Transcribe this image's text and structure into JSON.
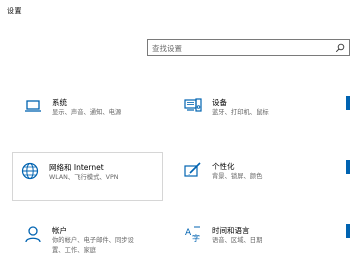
{
  "window": {
    "title": "设置"
  },
  "search": {
    "placeholder": "查找设置"
  },
  "tiles": [
    {
      "title": "系统",
      "desc": "显示、声音、通知、电源",
      "icon": "laptop-icon"
    },
    {
      "title": "设备",
      "desc": "蓝牙、打印机、鼠标",
      "icon": "devices-icon"
    },
    {
      "title": "网络和 Internet",
      "desc": "WLAN、飞行模式、VPN",
      "icon": "globe-icon"
    },
    {
      "title": "个性化",
      "desc": "背景、锁屏、颜色",
      "icon": "personalization-icon"
    },
    {
      "title": "帐户",
      "desc": "你的帐户、电子邮件、同步设\n置、工作、家庭",
      "icon": "person-icon"
    },
    {
      "title": "时间和语言",
      "desc": "语音、区域、日期",
      "icon": "time-language-icon"
    }
  ],
  "colors": {
    "accent": "#0063b1",
    "text": "#000000",
    "secondary_text": "#666666"
  }
}
